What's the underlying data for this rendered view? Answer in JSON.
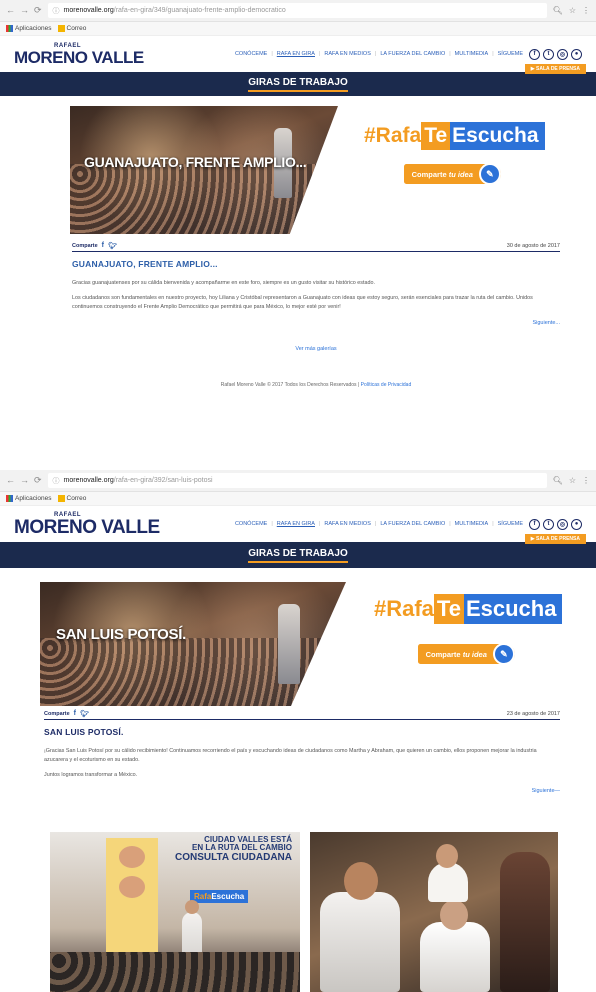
{
  "shot1": {
    "browser": {
      "url_domain": "morenovalle.org",
      "url_path": "/rafa-en-gira/349/guanajuato-frente-amplio-democratico",
      "bookmarks": [
        "Aplicaciones",
        "Correo"
      ]
    },
    "header": {
      "logo_small": "RAFAEL",
      "logo_big": "MORENO VALLE",
      "menu": [
        "CONÓCEME",
        "RAFA EN GIRA",
        "RAFA EN MEDIOS",
        "LA FUERZA DEL CAMBIO",
        "MULTIMEDIA",
        "SÍGUEME"
      ],
      "sala_prensa": "▶ SALA DE PRENSA"
    },
    "section_title": "GIRAS DE TRABAJO",
    "hero_title": "GUANAJUATO, FRENTE AMPLIO...",
    "share_label": "Comparte",
    "date": "30 de agosto de 2017",
    "article_title": "GUANAJUATO, FRENTE AMPLIO...",
    "paragraphs": [
      "Gracias guanajuatenses por su cálida bienvenida y acompañarme en este foro, siempre es un gusto visitar su histórico estado.",
      "Los ciudadanos son fundamentales en nuestro proyecto, hoy Liliana y Cristóbal representaron a Guanajuato con ideas que estoy seguro, serán esenciales para trazar la ruta del cambio. Unidos continuemos construyendo el Frente Amplio Democrático que permitirá que para México, lo mejor esté por venir!"
    ],
    "next_link": "Siguiente...",
    "ver_mas": "Ver más galerías",
    "footer": "Rafael Moreno Valle © 2017 Todos los Derechos Reservados |",
    "footer_link": "Políticas de Privacidad"
  },
  "shot2": {
    "browser": {
      "url_domain": "morenovalle.org",
      "url_path": "/rafa-en-gira/392/san-luis-potosi",
      "bookmarks": [
        "Aplicaciones",
        "Correo"
      ]
    },
    "header": {
      "logo_small": "RAFAEL",
      "logo_big": "MORENO VALLE",
      "menu": [
        "CONÓCEME",
        "RAFA EN GIRA",
        "RAFA EN MEDIOS",
        "LA FUERZA DEL CAMBIO",
        "MULTIMEDIA",
        "SÍGUEME"
      ],
      "sala_prensa": "▶ SALA DE PRENSA"
    },
    "section_title": "GIRAS DE TRABAJO",
    "hero_title": "SAN LUIS POTOSÍ.",
    "share_label": "Comparte",
    "date": "23 de agosto de 2017",
    "article_title": "SAN LUIS POTOSÍ.",
    "paragraphs": [
      "¡Gracias San Luis Potosí por su cálido recibimiento! Continuamos recorriendo el país y escuchando ideas de ciudadanos como Martha y Abraham, que quieren un cambio, ellos proponen mejorar la industria azucarera y el ecoturismo en su estado.",
      "Juntos logramos transformar a México."
    ],
    "next_link": "Siguiente—",
    "photo1_text": [
      "CIUDAD VALLES ESTÁ",
      "EN LA RUTA DEL CAMBIO",
      "CONSULTA CIUDADANA"
    ]
  },
  "campaign": {
    "hashtag_pre": "#Rafa",
    "hashtag_te": "Te",
    "hashtag_post": "Escucha",
    "comparte_btn_a": "Comparte",
    "comparte_btn_b": "tu idea",
    "mini_tag_pre": "Rafa",
    "mini_tag_post": "Escucha"
  },
  "colors": {
    "navy": "#1b2a4d",
    "brand_blue": "#2c72d8",
    "orange": "#f39c21",
    "logo_navy": "#1d2b66"
  },
  "icons": [
    "back-arrow-icon",
    "forward-arrow-icon",
    "reload-icon",
    "info-icon",
    "zoom-icon",
    "star-icon",
    "menu-dots-icon",
    "facebook-icon",
    "twitter-icon",
    "instagram-icon",
    "user-icon",
    "idea-icon"
  ]
}
